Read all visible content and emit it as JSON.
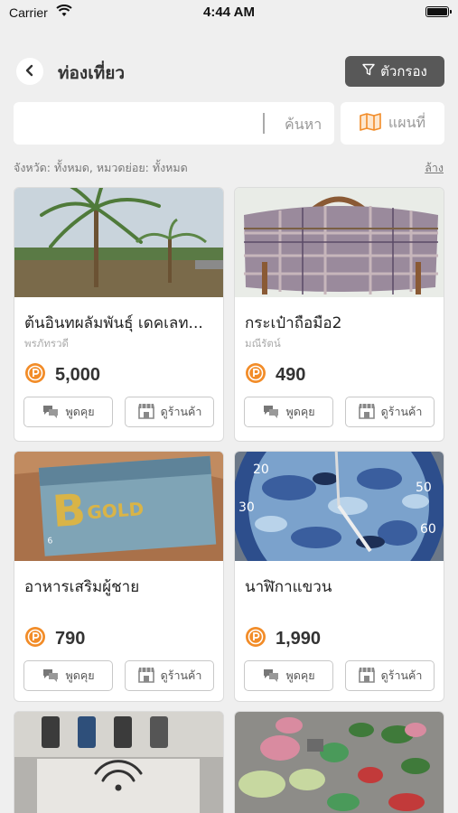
{
  "status_bar": {
    "carrier": "Carrier",
    "time": "4:44 AM"
  },
  "header": {
    "title": "ท่องเที่ยว",
    "filter_label": "ตัวกรอง"
  },
  "search": {
    "value": "",
    "placeholder": "",
    "search_label": "ค้นหา",
    "map_label": "แผนที่"
  },
  "filter_summary": "จังหวัด: ทั้งหมด, หมวดย่อย: ทั้งหมด",
  "clear_label": "ล้าง",
  "button_labels": {
    "chat": "พูดคุย",
    "shop": "ดูร้านค้า"
  },
  "accent_color": "#f28c28",
  "products": [
    {
      "name": "ต้นอินทผลัมพันธุ์ เดคเลท...",
      "seller": "พรภัทรวดี",
      "price": "5,000"
    },
    {
      "name": "กระเป๋าถือมือ2",
      "seller": "มณีรัตน์",
      "price": "490"
    },
    {
      "name": "อาหารเสริมผู้ชาย",
      "seller": "",
      "price": "790"
    },
    {
      "name": "นาฬิกาแขวน",
      "seller": "",
      "price": "1,990"
    },
    {
      "name": "",
      "seller": "",
      "price": ""
    },
    {
      "name": "",
      "seller": "",
      "price": ""
    }
  ],
  "image_text": {
    "product3_logo": "B GOLD"
  }
}
